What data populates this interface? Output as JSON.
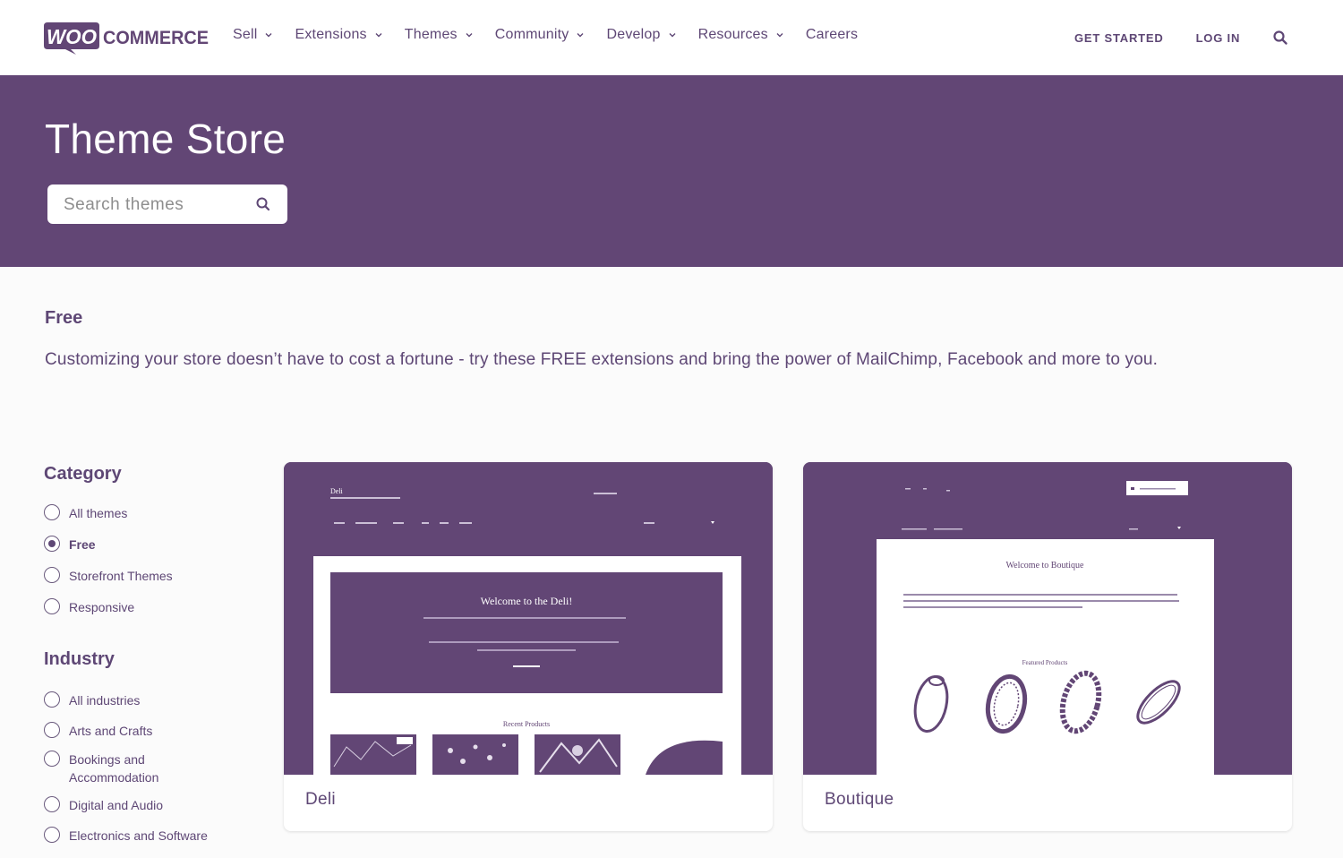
{
  "brand": {
    "woo": "WOO",
    "commerce": "COMMERCE"
  },
  "nav": {
    "items": [
      {
        "label": "Sell",
        "has_dropdown": true
      },
      {
        "label": "Extensions",
        "has_dropdown": true
      },
      {
        "label": "Themes",
        "has_dropdown": true
      },
      {
        "label": "Community",
        "has_dropdown": true
      },
      {
        "label": "Develop",
        "has_dropdown": true
      },
      {
        "label": "Resources",
        "has_dropdown": true
      },
      {
        "label": "Careers",
        "has_dropdown": false
      }
    ],
    "get_started": "GET STARTED",
    "log_in": "LOG IN"
  },
  "hero": {
    "title": "Theme Store",
    "search_placeholder": "Search themes"
  },
  "section": {
    "title": "Free",
    "description": "Customizing your store doesn’t have to cost a fortune - try these FREE extensions and bring the power of MailChimp, Facebook and more to you."
  },
  "filters": {
    "category": {
      "heading": "Category",
      "options": [
        {
          "label": "All themes",
          "checked": false
        },
        {
          "label": "Free",
          "checked": true
        },
        {
          "label": "Storefront Themes",
          "checked": false
        },
        {
          "label": "Responsive",
          "checked": false
        }
      ]
    },
    "industry": {
      "heading": "Industry",
      "options": [
        {
          "label": "All industries",
          "checked": false
        },
        {
          "label": "Arts and Crafts",
          "checked": false
        },
        {
          "label": "Bookings and Accommodation",
          "checked": false
        },
        {
          "label": "Digital and Audio",
          "checked": false
        },
        {
          "label": "Electronics and Software",
          "checked": false
        }
      ]
    }
  },
  "themes": [
    {
      "name": "Deli",
      "preview": {
        "site_title": "Deli",
        "welcome": "Welcome to the Deli!",
        "section": "Recent Products"
      }
    },
    {
      "name": "Boutique",
      "preview": {
        "welcome": "Welcome to Boutique",
        "section": "Featured Products"
      }
    }
  ],
  "colors": {
    "brand_purple": "#624675",
    "text_purple": "#5e4775",
    "background": "#fbfbfb",
    "white": "#ffffff"
  }
}
